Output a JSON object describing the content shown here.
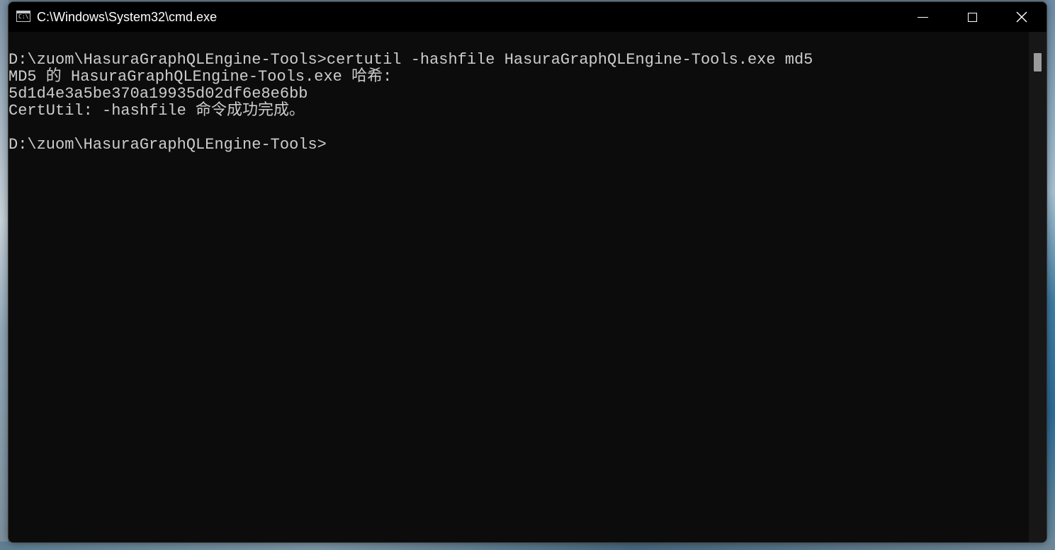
{
  "window": {
    "title": "C:\\Windows\\System32\\cmd.exe",
    "icon": "console-app-icon"
  },
  "caption_buttons": {
    "minimize": "minimize-icon",
    "maximize": "maximize-icon",
    "close": "close-icon"
  },
  "console": {
    "lines": [
      "D:\\zuom\\HasuraGraphQLEngine-Tools>certutil -hashfile HasuraGraphQLEngine-Tools.exe md5",
      "MD5 的 HasuraGraphQLEngine-Tools.exe 哈希:",
      "5d1d4e3a5be370a19935d02df6e8e6bb",
      "CertUtil: -hashfile 命令成功完成。",
      "",
      "D:\\zuom\\HasuraGraphQLEngine-Tools>"
    ],
    "background": "#0c0c0c",
    "foreground": "#cccccc"
  }
}
